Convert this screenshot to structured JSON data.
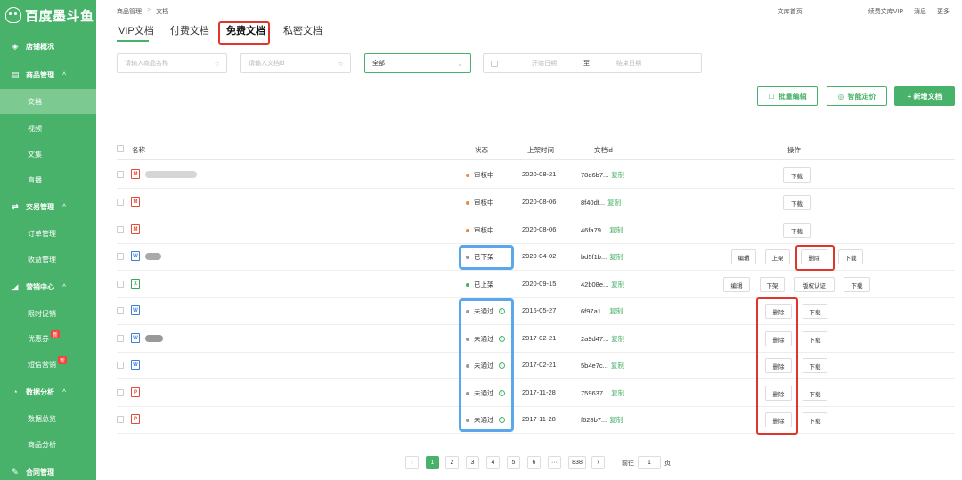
{
  "brand": {
    "logo_text": "百度墨斗鱼"
  },
  "sidebar": {
    "groups": [
      {
        "label": "店铺概况",
        "icon": "layers-icon"
      },
      {
        "label": "商品管理",
        "icon": "box-icon"
      },
      {
        "label": "交易管理",
        "icon": "exchange-icon"
      },
      {
        "label": "营销中心",
        "icon": "chart-icon"
      },
      {
        "label": "数据分析",
        "icon": "pie-icon"
      },
      {
        "label": "合同管理",
        "icon": "contract-icon"
      }
    ],
    "items": [
      {
        "label": "文档",
        "active": true
      },
      {
        "label": "视频"
      },
      {
        "label": "文集"
      },
      {
        "label": "直播"
      },
      {
        "label": "订单管理"
      },
      {
        "label": "收益管理"
      },
      {
        "label": "限时促销"
      },
      {
        "label": "优惠券",
        "badge": "新"
      },
      {
        "label": "短信营销",
        "badge": "新"
      },
      {
        "label": "数据总览"
      },
      {
        "label": "商品分析"
      }
    ]
  },
  "breadcrumb": {
    "parent": "商品管理",
    "sep": ">",
    "current": "文档"
  },
  "topnav": {
    "home": "文库首页",
    "vip": "续费文库VIP",
    "messages": "消息",
    "more": "更多"
  },
  "tabs": [
    "VIP文档",
    "付费文档",
    "免费文档",
    "私密文档"
  ],
  "filters": {
    "product_name_placeholder": "请输入商品名称",
    "doc_id_placeholder": "请输入文档id",
    "status_select": "全部",
    "start_date_placeholder": "开始日期",
    "to": "至",
    "end_date_placeholder": "结束日期"
  },
  "actions": {
    "batch_edit": "批量编辑",
    "smart_price": "智能定价",
    "add_doc": "+ 新增文档"
  },
  "table": {
    "headers": {
      "name": "名称",
      "status": "状态",
      "publish_time": "上架时间",
      "doc_id": "文档id",
      "ops": "操作"
    },
    "copy_label": "复制",
    "rows": [
      {
        "type": "M",
        "status": "审核中",
        "status_color": "#f0883a",
        "date": "2020-08-21",
        "id": "78d6b7...",
        "ops": [
          "下载"
        ]
      },
      {
        "type": "M",
        "status": "审核中",
        "status_color": "#f0883a",
        "date": "2020-08-06",
        "id": "8f40df...",
        "ops": [
          "下载"
        ]
      },
      {
        "type": "M",
        "status": "审核中",
        "status_color": "#f0883a",
        "date": "2020-08-06",
        "id": "46fa79...",
        "ops": [
          "下载"
        ]
      },
      {
        "type": "W",
        "status": "已下架",
        "status_color": "#999999",
        "date": "2020-04-02",
        "id": "bd5f1b...",
        "ops": [
          "编辑",
          "上架",
          "删除",
          "下载"
        ]
      },
      {
        "type": "X",
        "status": "已上架",
        "status_color": "#49b26a",
        "date": "2020-09-15",
        "id": "42b08e...",
        "ops": [
          "编辑",
          "下架",
          "版权认证",
          "下载"
        ]
      },
      {
        "type": "W",
        "status": "未通过",
        "status_color": "#999999",
        "date": "2016-05-27",
        "id": "6f97a1...",
        "ops": [
          "删除",
          "下载"
        ]
      },
      {
        "type": "W",
        "status": "未通过",
        "status_color": "#999999",
        "date": "2017-02-21",
        "id": "2a9d47...",
        "ops": [
          "删除",
          "下载"
        ]
      },
      {
        "type": "W",
        "status": "未通过",
        "status_color": "#999999",
        "date": "2017-02-21",
        "id": "5b4e7c...",
        "ops": [
          "删除",
          "下载"
        ]
      },
      {
        "type": "P",
        "status": "未通过",
        "status_color": "#999999",
        "date": "2017-11-28",
        "id": "759637...",
        "ops": [
          "删除",
          "下载"
        ]
      },
      {
        "type": "P",
        "status": "未通过",
        "status_color": "#999999",
        "date": "2017-11-28",
        "id": "f628b7...",
        "ops": [
          "删除",
          "下载"
        ]
      }
    ]
  },
  "pagination": {
    "pages": [
      "1",
      "2",
      "3",
      "4",
      "5",
      "6",
      "···",
      "838"
    ],
    "goto_prefix": "前往",
    "goto_value": "1",
    "goto_suffix": "页"
  },
  "colors": {
    "brand_green": "#49b26a",
    "highlight_red": "#e0352b",
    "highlight_blue": "#5aa8ea"
  }
}
